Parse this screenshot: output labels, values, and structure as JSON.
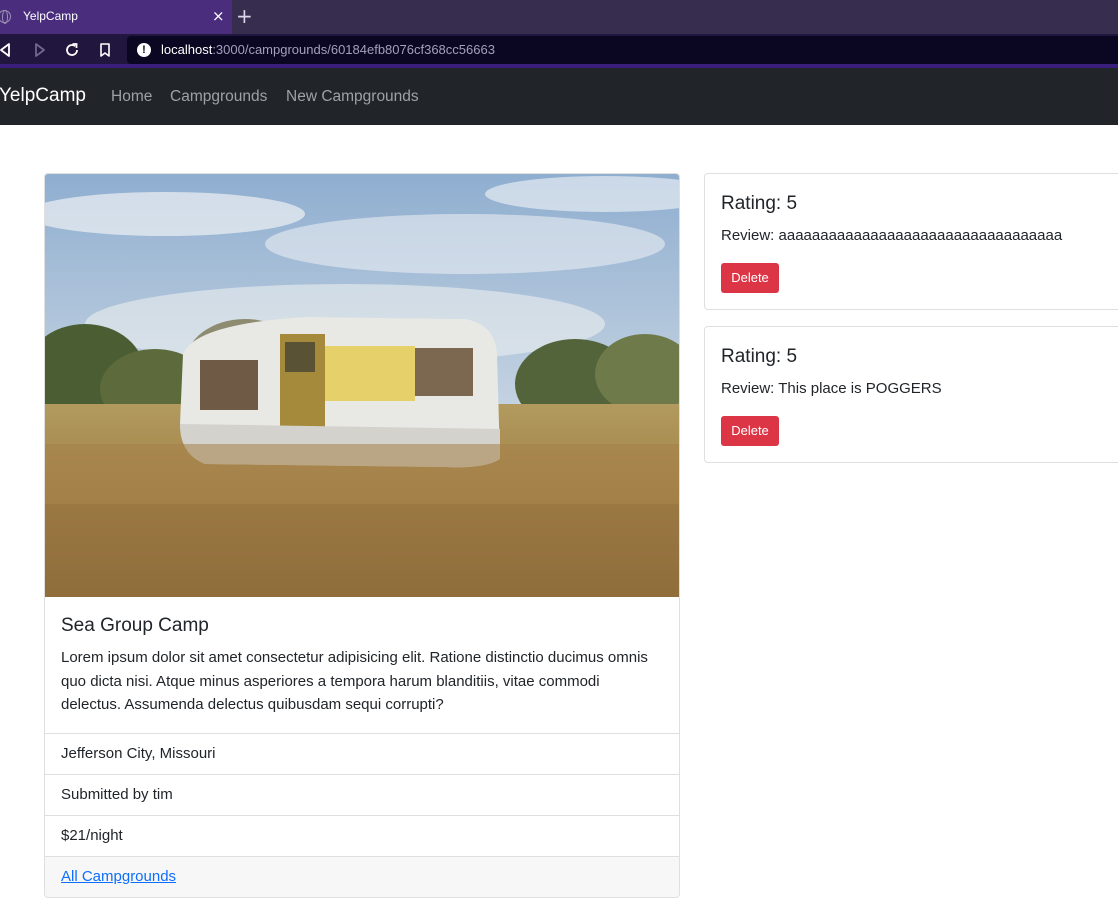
{
  "browser": {
    "tab_title": "YelpCamp",
    "tab_close": "×",
    "new_tab": "+",
    "url_host": "localhost",
    "url_path": ":3000/campgrounds/60184efb8076cf368cc56663",
    "info_icon": "!"
  },
  "navbar": {
    "brand": "YelpCamp",
    "links": [
      "Home",
      "Campgrounds",
      "New Campgrounds"
    ]
  },
  "campground": {
    "image_alt": "old white camper trailer in tall dry grass",
    "title": "Sea Group Camp",
    "description": "Lorem ipsum dolor sit amet consectetur adipisicing elit. Ratione distinctio ducimus omnis quo dicta nisi. Atque minus asperiores a tempora harum blanditiis, vitae commodi delectus. Assumenda delectus quibusdam sequi corrupti?",
    "location": "Jefferson City, Missouri",
    "submitted_by": "Submitted by tim",
    "price": "$21/night",
    "back_link": "All Campgrounds"
  },
  "reviews": [
    {
      "rating": "Rating: 5",
      "text": "Review: aaaaaaaaaaaaaaaaaaaaaaaaaaaaaaaaaa",
      "delete_label": "Delete"
    },
    {
      "rating": "Rating: 5",
      "text": "Review: This place is POGGERS",
      "delete_label": "Delete"
    }
  ],
  "colors": {
    "navbar_bg": "#212529",
    "danger": "#dc3545",
    "link": "#0d6efd",
    "tabbar_bg": "#372d4f"
  }
}
